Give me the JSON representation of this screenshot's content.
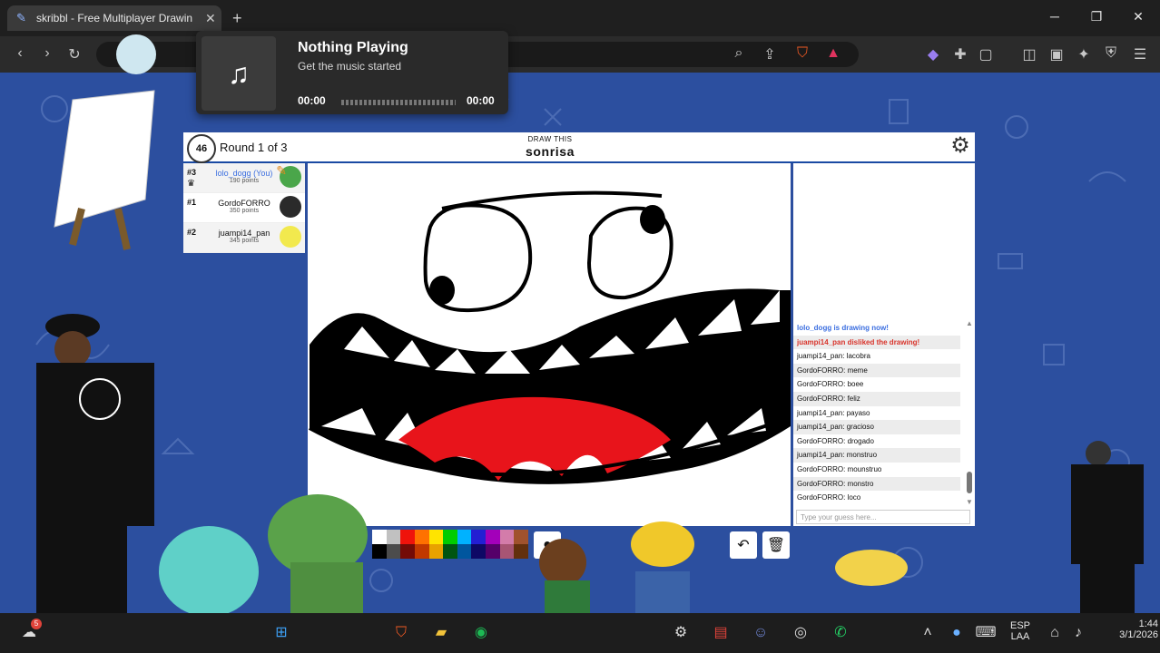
{
  "browser": {
    "tab_title": "skribbl - Free Multiplayer Drawin",
    "tab_close": "✕",
    "new_tab": "+",
    "window_controls": {
      "minimize": "─",
      "restore": "❐",
      "close": "✕"
    }
  },
  "media_popup": {
    "title": "Nothing Playing",
    "subtitle": "Get the music started",
    "time_start": "00:00",
    "time_end": "00:00",
    "art_icon": "♫"
  },
  "game": {
    "timer": "46",
    "round": "Round 1 of 3",
    "hint_label": "DRAW THIS",
    "word": "sonrisa",
    "players": [
      {
        "rank": "#3",
        "name": "lolo_dogg (You)",
        "points": "190 points",
        "color": "#4aa64a",
        "drawing": true
      },
      {
        "rank": "#1",
        "name": "GordoFORRO",
        "points": "350 points",
        "color": "#2a2a2a"
      },
      {
        "rank": "#2",
        "name": "juampi14_pan",
        "points": "345 points",
        "color": "#f2e94e"
      }
    ]
  },
  "chat": {
    "messages": [
      {
        "text": "lolo_dogg is drawing now!",
        "kind": "sys-blue"
      },
      {
        "text": "juampi14_pan disliked the drawing!",
        "kind": "sys-red"
      },
      {
        "text": "juampi14_pan: lacobra",
        "kind": ""
      },
      {
        "text": "GordoFORRO: meme",
        "kind": ""
      },
      {
        "text": "GordoFORRO: boee",
        "kind": ""
      },
      {
        "text": "GordoFORRO: feliz",
        "kind": ""
      },
      {
        "text": "juampi14_pan: payaso",
        "kind": ""
      },
      {
        "text": "juampi14_pan: gracioso",
        "kind": ""
      },
      {
        "text": "GordoFORRO: drogado",
        "kind": ""
      },
      {
        "text": "juampi14_pan: monstruo",
        "kind": ""
      },
      {
        "text": "GordoFORRO: mounstruo",
        "kind": ""
      },
      {
        "text": "GordoFORRO: monstro",
        "kind": ""
      },
      {
        "text": "GordoFORRO: loco",
        "kind": ""
      }
    ],
    "placeholder": "Type your guess here..."
  },
  "palette": [
    "#ffffff",
    "#c1c1c1",
    "#ef130b",
    "#ff7100",
    "#ffe400",
    "#00cc00",
    "#00b2ff",
    "#231fd3",
    "#a300ba",
    "#d37caa",
    "#a0522d",
    "#000000",
    "#4c4c4c",
    "#740b07",
    "#c23800",
    "#e8a200",
    "#005510",
    "#00569e",
    "#0e0865",
    "#550069",
    "#a75574",
    "#63300d"
  ],
  "tools": {
    "brush": "●",
    "undo": "↶",
    "trash": "🗑"
  },
  "taskbar": {
    "language": "ESP",
    "layout": "LAA",
    "time": "1:44",
    "date": "3/1/2026",
    "weather_badge": "5"
  }
}
